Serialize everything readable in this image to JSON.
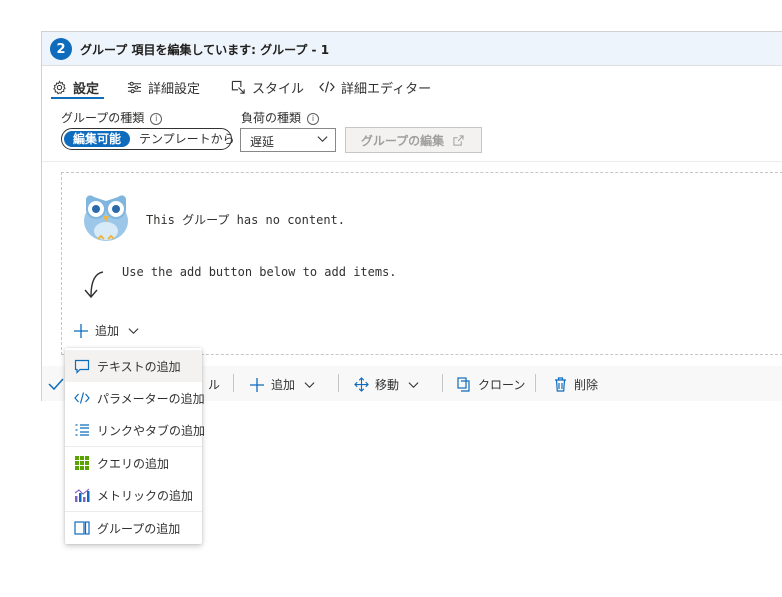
{
  "header": {
    "step": "2",
    "title": "グループ 項目を編集しています: グループ - 1"
  },
  "tabs": [
    {
      "label": "設定",
      "icon": "gear-icon",
      "active": true
    },
    {
      "label": "詳細設定",
      "icon": "sliders-icon",
      "active": false
    },
    {
      "label": "スタイル",
      "icon": "style-icon",
      "active": false
    },
    {
      "label": "詳細エディター",
      "icon": "code-icon",
      "active": false
    }
  ],
  "fields": {
    "group_type_label": "グループの種類",
    "group_type_options": [
      "編集可能",
      "テンプレートから"
    ],
    "load_type_label": "負荷の種類",
    "load_type_value": "遅延",
    "edit_group_button": "グループの編集"
  },
  "content": {
    "empty_message": "This グループ has no content.",
    "hint": "Use the add button below to add items.",
    "add_label": "追加"
  },
  "toolbar": {
    "done_fragment": "ル",
    "add_label": "追加",
    "move_label": "移動",
    "clone_label": "クローン",
    "delete_label": "削除"
  },
  "menu": {
    "items": [
      {
        "label": "テキストの追加",
        "icon": "comment-icon"
      },
      {
        "label": "パラメーターの追加",
        "icon": "code-icon"
      },
      {
        "label": "リンクやタブの追加",
        "icon": "list-icon"
      },
      {
        "label": "クエリの追加",
        "icon": "grid-icon"
      },
      {
        "label": "メトリックの追加",
        "icon": "metric-chart-icon"
      },
      {
        "label": "グループの追加",
        "icon": "group-icon"
      }
    ]
  },
  "colors": {
    "accent": "#0f6cbd",
    "header_bg": "#eef4fb",
    "query_green": "#57a300",
    "metric_purple": "#8661c5"
  }
}
